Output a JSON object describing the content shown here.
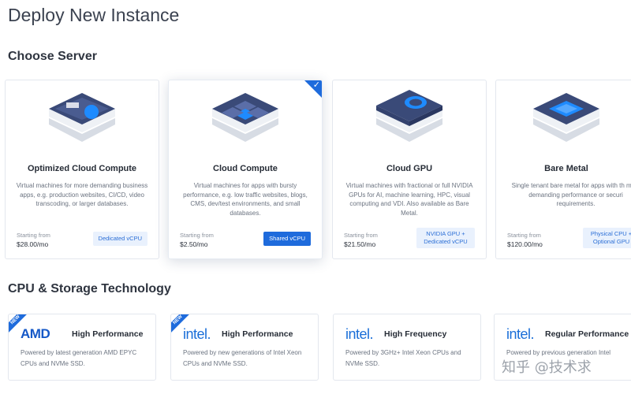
{
  "page": {
    "title": "Deploy New Instance"
  },
  "sections": {
    "server": "Choose Server",
    "tech": "CPU & Storage Technology"
  },
  "servers": [
    {
      "name": "Optimized Cloud Compute",
      "desc": "Virtual machines for more demanding business apps, e.g. production websites, CI/CD, video transcoding, or larger databases.",
      "price_label": "Starting from",
      "price": "$28.00/mo",
      "badge": "Dedicated vCPU",
      "selected": false
    },
    {
      "name": "Cloud Compute",
      "desc": "Virtual machines for apps with bursty performance, e.g. low traffic websites, blogs, CMS, dev/test environments, and small databases.",
      "price_label": "Starting from",
      "price": "$2.50/mo",
      "badge": "Shared vCPU",
      "selected": true
    },
    {
      "name": "Cloud GPU",
      "desc": "Virtual machines with fractional or full NVIDIA GPUs for AI, machine learning, HPC, visual computing and VDI. Also available as Bare Metal.",
      "price_label": "Starting from",
      "price": "$21.50/mo",
      "badge": "NVIDIA GPU + Dedicated vCPU",
      "selected": false
    },
    {
      "name": "Bare Metal",
      "desc": "Single tenant bare metal for apps with th most demanding performance or securi requirements.",
      "price_label": "Starting from",
      "price": "$120.00/mo",
      "badge": "Physical CPU + Optional GPU",
      "selected": false
    }
  ],
  "tech": [
    {
      "logo": "AMD",
      "title": "High Performance",
      "desc": "Powered by latest generation AMD EPYC CPUs and NVMe SSD.",
      "new": "NEW"
    },
    {
      "logo": "intel.",
      "title": "High Performance",
      "desc": "Powered by new generations of Intel Xeon CPUs and NVMe SSD.",
      "new": "NEW"
    },
    {
      "logo": "intel.",
      "title": "High Frequency",
      "desc": "Powered by 3GHz+ Intel Xeon CPUs and NVMe SSD.",
      "new": ""
    },
    {
      "logo": "intel.",
      "title": "Regular Performance",
      "desc": "Powered by previous generation Intel",
      "new": ""
    }
  ],
  "watermark": "知乎 @技术求",
  "colors": {
    "accent": "#1e6bdc",
    "card_art": "#3a4a78",
    "card_art_light": "#5b6ea8"
  },
  "icons": {
    "check": "check-icon",
    "server_art": "isometric-server-icon"
  }
}
